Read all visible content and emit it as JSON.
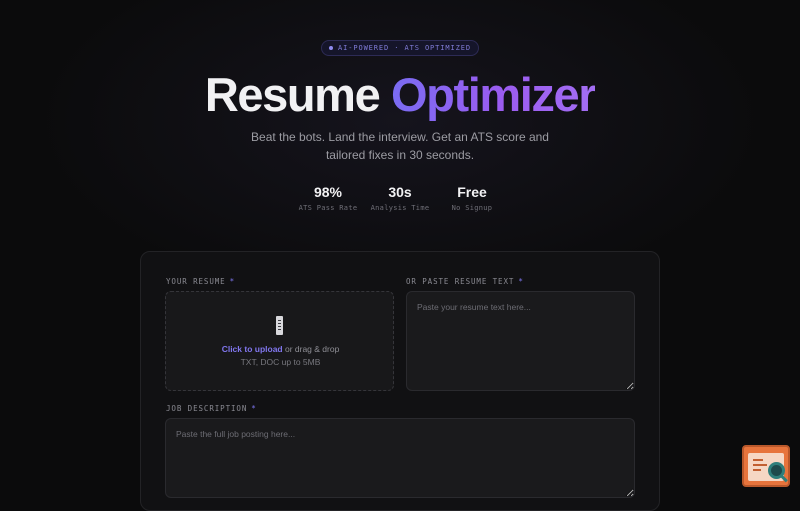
{
  "hero": {
    "badge": "AI-POWERED · ATS OPTIMIZED",
    "title_main": "Resume",
    "title_accent": "Optimizer",
    "subtitle_line1": "Beat the bots. Land the interview. Get an ATS score and",
    "subtitle_line2": "tailored fixes in 30 seconds."
  },
  "stats": [
    {
      "value": "98%",
      "label": "ATS Pass Rate"
    },
    {
      "value": "30s",
      "label": "Analysis Time"
    },
    {
      "value": "Free",
      "label": "No Signup"
    }
  ],
  "form": {
    "resume_label": "YOUR RESUME",
    "paste_label": "OR PASTE RESUME TEXT",
    "required_mark": "*",
    "upload_link": "Click to upload",
    "upload_rest": " or drag & drop",
    "upload_hint": "TXT, DOC up to 5MB",
    "paste_placeholder": "Paste your resume text here...",
    "job_label": "JOB DESCRIPTION",
    "job_placeholder": "Paste the full job posting here..."
  },
  "icons": {
    "file": "file-icon",
    "help": "help-widget-icon"
  },
  "colors": {
    "accent": "#7a6cf2",
    "background": "#0b0b0c"
  }
}
